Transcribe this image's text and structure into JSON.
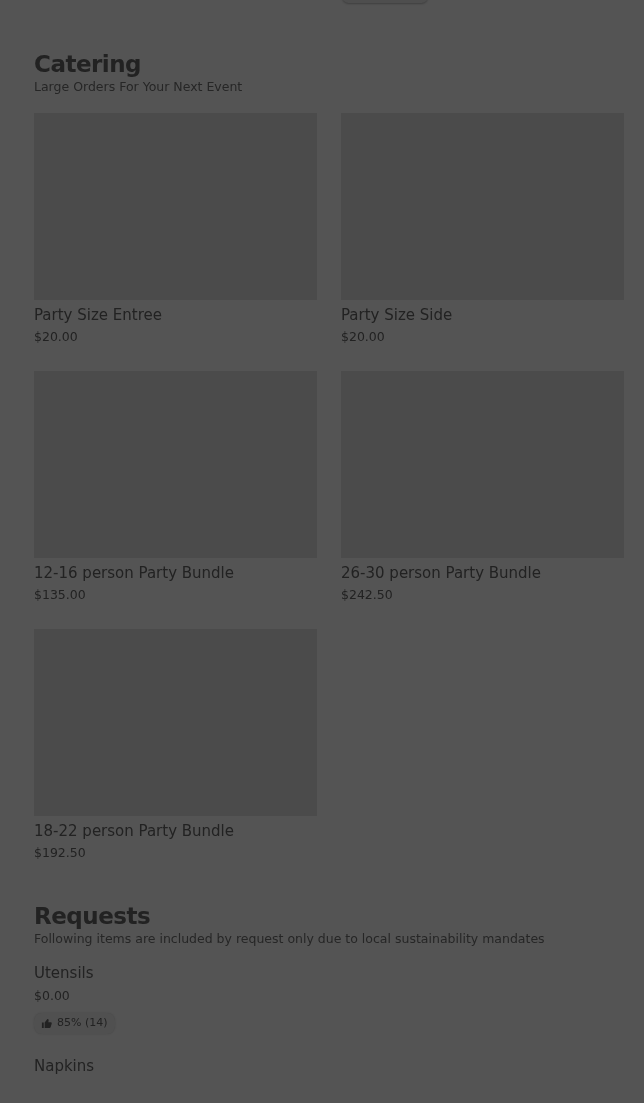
{
  "catering": {
    "title": "Catering",
    "subtitle": "Large Orders For Your Next Event",
    "items": [
      {
        "name": "Party Size Entree",
        "price": "$20.00"
      },
      {
        "name": "Party Size Side",
        "price": "$20.00"
      },
      {
        "name": "12-16 person Party Bundle",
        "price": "$135.00"
      },
      {
        "name": "26-30 person Party Bundle",
        "price": "$242.50"
      },
      {
        "name": "18-22 person Party Bundle",
        "price": "$192.50"
      }
    ]
  },
  "requests": {
    "title": "Requests",
    "subtitle": "Following items are included by request only due to local sustainability mandates",
    "items": [
      {
        "name": "Utensils",
        "price": "$0.00",
        "rating": "85% (14)"
      },
      {
        "name": "Napkins"
      }
    ]
  }
}
